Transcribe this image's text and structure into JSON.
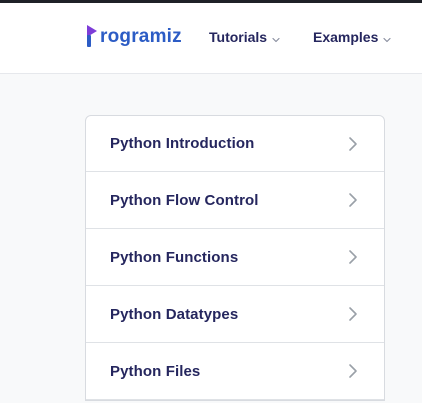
{
  "header": {
    "logo_text": "rogramiz",
    "nav": [
      {
        "label": "Tutorials"
      },
      {
        "label": "Examples"
      }
    ]
  },
  "topics": [
    {
      "label": "Python Introduction"
    },
    {
      "label": "Python Flow Control"
    },
    {
      "label": "Python Functions"
    },
    {
      "label": "Python Datatypes"
    },
    {
      "label": "Python Files"
    }
  ],
  "colors": {
    "brand_blue": "#2c5cc5",
    "brand_purple": "#7d3cd8",
    "text_dark": "#25265e",
    "chevron": "#9aa0a8"
  },
  "icons": [
    "programiz-logo-icon",
    "chevron-down-icon",
    "chevron-right-icon"
  ]
}
